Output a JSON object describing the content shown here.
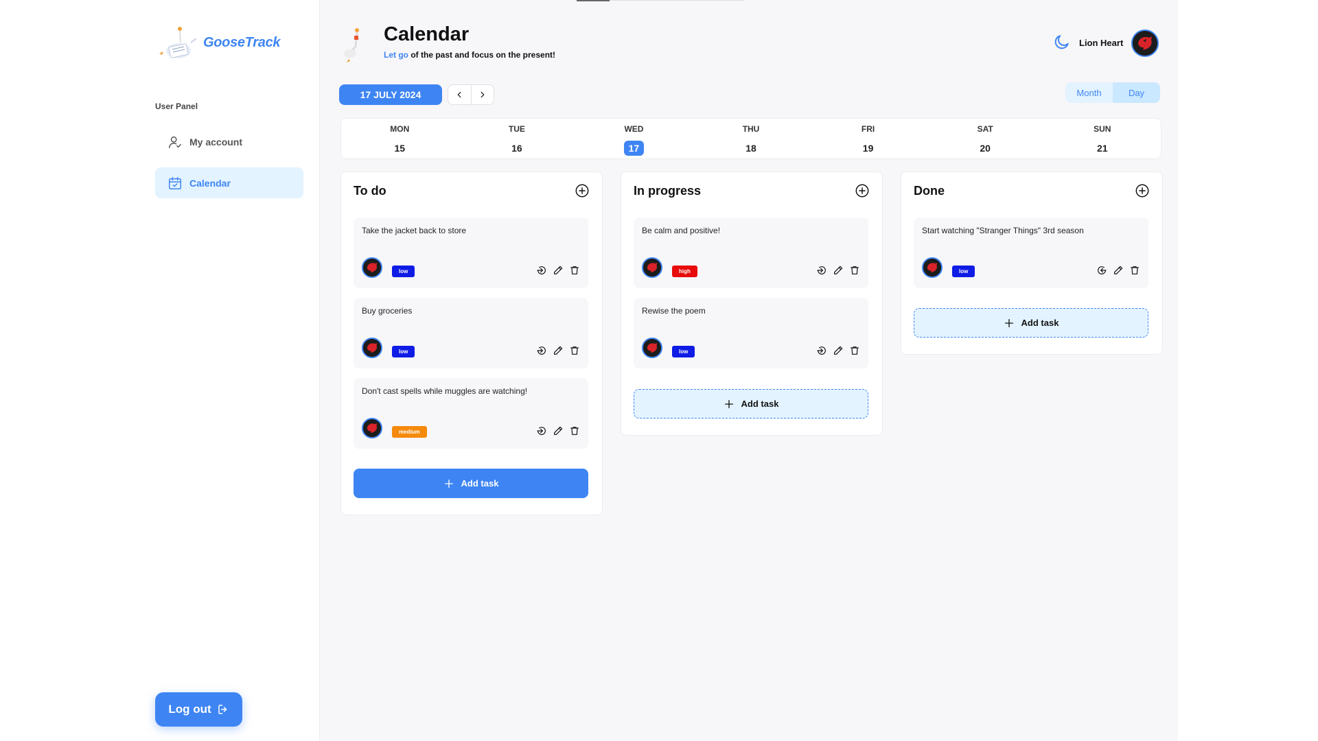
{
  "app": {
    "name": "GooseTrack"
  },
  "sidebar": {
    "panel_label": "User Panel",
    "items": [
      {
        "label": "My account",
        "icon": "user-check-icon"
      },
      {
        "label": "Calendar",
        "icon": "calendar-check-icon"
      }
    ],
    "logout_label": "Log out"
  },
  "header": {
    "title": "Calendar",
    "subtitle_accent": "Let go",
    "subtitle_rest": " of the past and focus on the present!",
    "user_name": "Lion Heart"
  },
  "toolbar": {
    "current_date": "17 JULY 2024",
    "view_month": "Month",
    "view_day": "Day",
    "active_view": "Day"
  },
  "week": [
    {
      "day": "MON",
      "date": "15"
    },
    {
      "day": "TUE",
      "date": "16"
    },
    {
      "day": "WED",
      "date": "17"
    },
    {
      "day": "THU",
      "date": "18"
    },
    {
      "day": "FRI",
      "date": "19"
    },
    {
      "day": "SAT",
      "date": "20"
    },
    {
      "day": "SUN",
      "date": "21"
    }
  ],
  "columns": [
    {
      "title": "To do",
      "tasks": [
        {
          "text": "Take the jacket back to store",
          "priority": "low"
        },
        {
          "text": "Buy groceries",
          "priority": "low"
        },
        {
          "text": "Don't cast spells while muggles are watching!",
          "priority": "medium"
        }
      ],
      "add_label": "Add task"
    },
    {
      "title": "In progress",
      "tasks": [
        {
          "text": "Be calm and positive!",
          "priority": "high"
        },
        {
          "text": "Rewise the poem",
          "priority": "low"
        }
      ],
      "add_label": "Add task"
    },
    {
      "title": "Done",
      "tasks": [
        {
          "text": "Start watching \"Stranger Things\" 3rd season",
          "priority": "low"
        }
      ],
      "add_label": "Add task"
    }
  ],
  "colors": {
    "accent": "#3e85f3",
    "priority_low": "#0f1ce6",
    "priority_medium": "#f58a0c",
    "priority_high": "#e80b0b"
  }
}
